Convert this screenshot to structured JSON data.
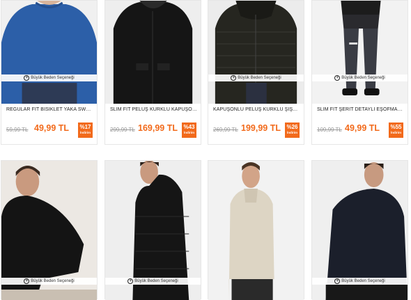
{
  "size_option_label": "Büyük Beden Seçeneği",
  "products": [
    {
      "title": "REGULAR FİT BİSİKLET YAKA SWEATSHİRT",
      "old_price": "59,99 TL",
      "new_price": "49,99 TL",
      "discount": "%17",
      "discount_label": "İndirim"
    },
    {
      "title": "SLİM FİT PELUŞ KÜRKLÜ KAPÜŞONLU MONT",
      "old_price": "299,99 TL",
      "new_price": "169,99 TL",
      "discount": "%43",
      "discount_label": "İndirim"
    },
    {
      "title": "KAPÜŞONLU PELUŞ KÜRKLÜ ŞİŞME KABAN",
      "old_price": "269,99 TL",
      "new_price": "199,99 TL",
      "discount": "%26",
      "discount_label": "İndirim"
    },
    {
      "title": "SLİM FİT ŞERİT DETAYLI EŞOFMAN ALTI",
      "old_price": "109,99 TL",
      "new_price": "49,99 TL",
      "discount": "%55",
      "discount_label": "İndirim"
    },
    {
      "title": "",
      "old_price": "",
      "new_price": "",
      "discount": "",
      "discount_label": ""
    },
    {
      "title": "",
      "old_price": "",
      "new_price": "",
      "discount": "",
      "discount_label": ""
    },
    {
      "title": "",
      "old_price": "",
      "new_price": "",
      "discount": "",
      "discount_label": ""
    },
    {
      "title": "",
      "old_price": "",
      "new_price": "",
      "discount": "",
      "discount_label": ""
    }
  ],
  "colors": {
    "accent": "#f26a1b"
  }
}
